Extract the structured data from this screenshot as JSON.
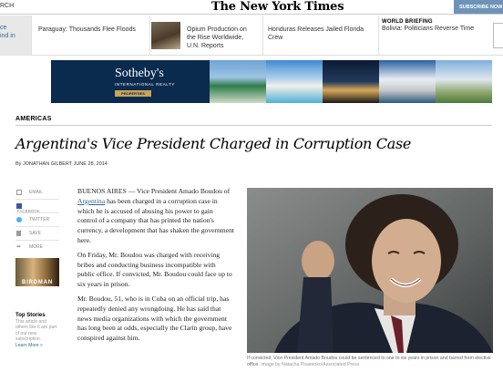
{
  "topbar": {
    "search_label": "RCH",
    "logo_text": "The New York Times",
    "subscribe_label": "SUBSCRIBE NOW"
  },
  "strip": {
    "first_text": "ce ind in",
    "item1": "Paraguay: Thousands Flee Floods",
    "item2": "Opium Production on the Rise Worldwide, U.N. Reports",
    "item3": "Honduras Releases Jailed Florida Crew",
    "item4_kicker": "WORLD BRIEFING",
    "item4": "Bolivia: Politicians Reverse Time"
  },
  "ad": {
    "brand": "Sotheby's",
    "sub": "INTERNATIONAL REALTY",
    "button": "PROPERTIES"
  },
  "article": {
    "section": "AMERICAS",
    "headline": "Argentina's Vice President Charged in Corruption Case",
    "byline": "By JONATHAN GILBERT   JUNE 28, 2014",
    "p1_pre": "BUENOS AIRES — Vice President Amado Boudou of ",
    "p1_link": "Argentina",
    "p1_post": " has been charged in a corruption case in which he is accused of abusing his power to gain control of a company that has printed the nation's currency, a development that has shaken the government here.",
    "p2": "On Friday, Mr. Boudou was charged with receiving bribes and conducting business incompatible with public office. If convicted, Mr. Boudou could face up to six years in prison.",
    "p3": "Mr. Boudou, 51, who is in Cuba on an official trip, has repeatedly denied any wrongdoing. He has said that news media organizations with which the government has long been at odds, especially the Clarín group, have conspired against him.",
    "caption": "If convicted, Vice President Amado Boudou could be sentenced to one to six years in prison and barred from elective office.",
    "credit": " Image by Natacha Pisarenko/Associated Press"
  },
  "share": {
    "email": "EMAIL",
    "facebook": "FACEBOOK",
    "twitter": "TWITTER",
    "save": "SAVE",
    "more": "MORE"
  },
  "promo": {
    "word": "BIRDMAN",
    "top_stories": "Top Stories",
    "top_stories_text": "This article and others like it are part of our new subscription.",
    "learn_more": "Learn More »"
  }
}
